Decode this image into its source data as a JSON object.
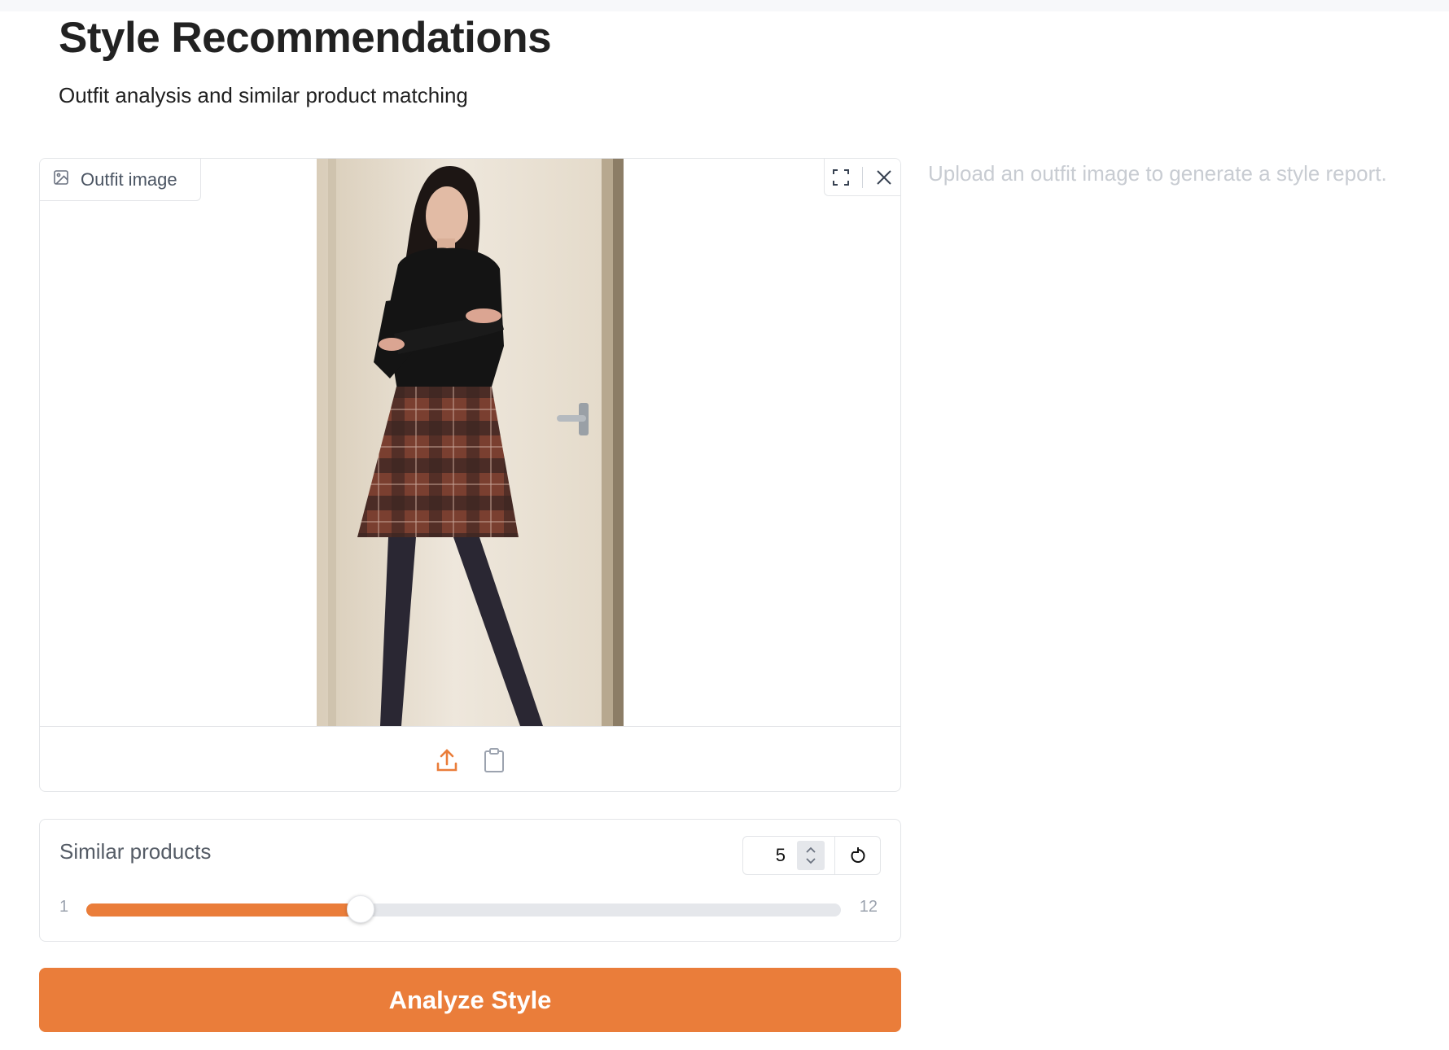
{
  "header": {
    "title": "Style Recommendations",
    "subtitle": "Outfit analysis and similar product matching"
  },
  "image_input": {
    "label": "Outfit image",
    "label_icon": "image-icon",
    "controls": [
      "fullscreen-icon",
      "close-icon"
    ],
    "footer_actions": [
      "upload-icon",
      "clipboard-icon"
    ],
    "photo_description_colors": {
      "wall": "#e8dfd0",
      "top": "#141414",
      "skirt": "#7a3f30",
      "tights": "#2a2733"
    }
  },
  "output": {
    "placeholder": "Upload an outfit image to generate a style report."
  },
  "slider": {
    "label": "Similar products",
    "value": "5",
    "min": "1",
    "max": "12",
    "fraction": 0.364,
    "reset_icon": "reset-icon"
  },
  "actions": {
    "analyze_label": "Analyze Style"
  },
  "colors": {
    "accent": "#ea7d3a",
    "border": "#e3e5e8",
    "muted_text": "#c8ccd2"
  }
}
